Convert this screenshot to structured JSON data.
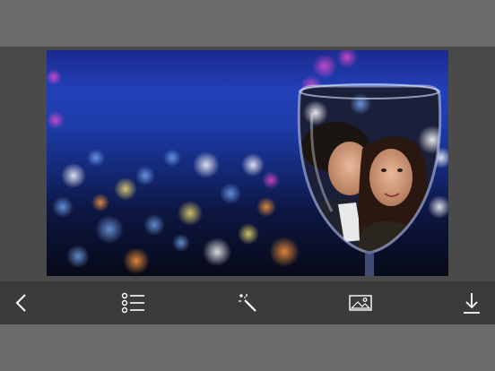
{
  "screen": {
    "photo": {
      "subject": "couple-in-wine-glass-over-city-bokeh"
    },
    "toolbar": {
      "tools": [
        {
          "name": "back",
          "icon": "chevron-left-icon"
        },
        {
          "name": "frames-list",
          "icon": "list-icon"
        },
        {
          "name": "effects",
          "icon": "magic-wand-icon"
        },
        {
          "name": "gallery",
          "icon": "image-icon"
        },
        {
          "name": "download",
          "icon": "download-icon"
        }
      ]
    },
    "colors": {
      "top_bar": "#6b6b6b",
      "canvas_bg": "#4a4a4a",
      "toolbar_bg": "#3b3b3b",
      "icon": "#ffffff"
    }
  }
}
